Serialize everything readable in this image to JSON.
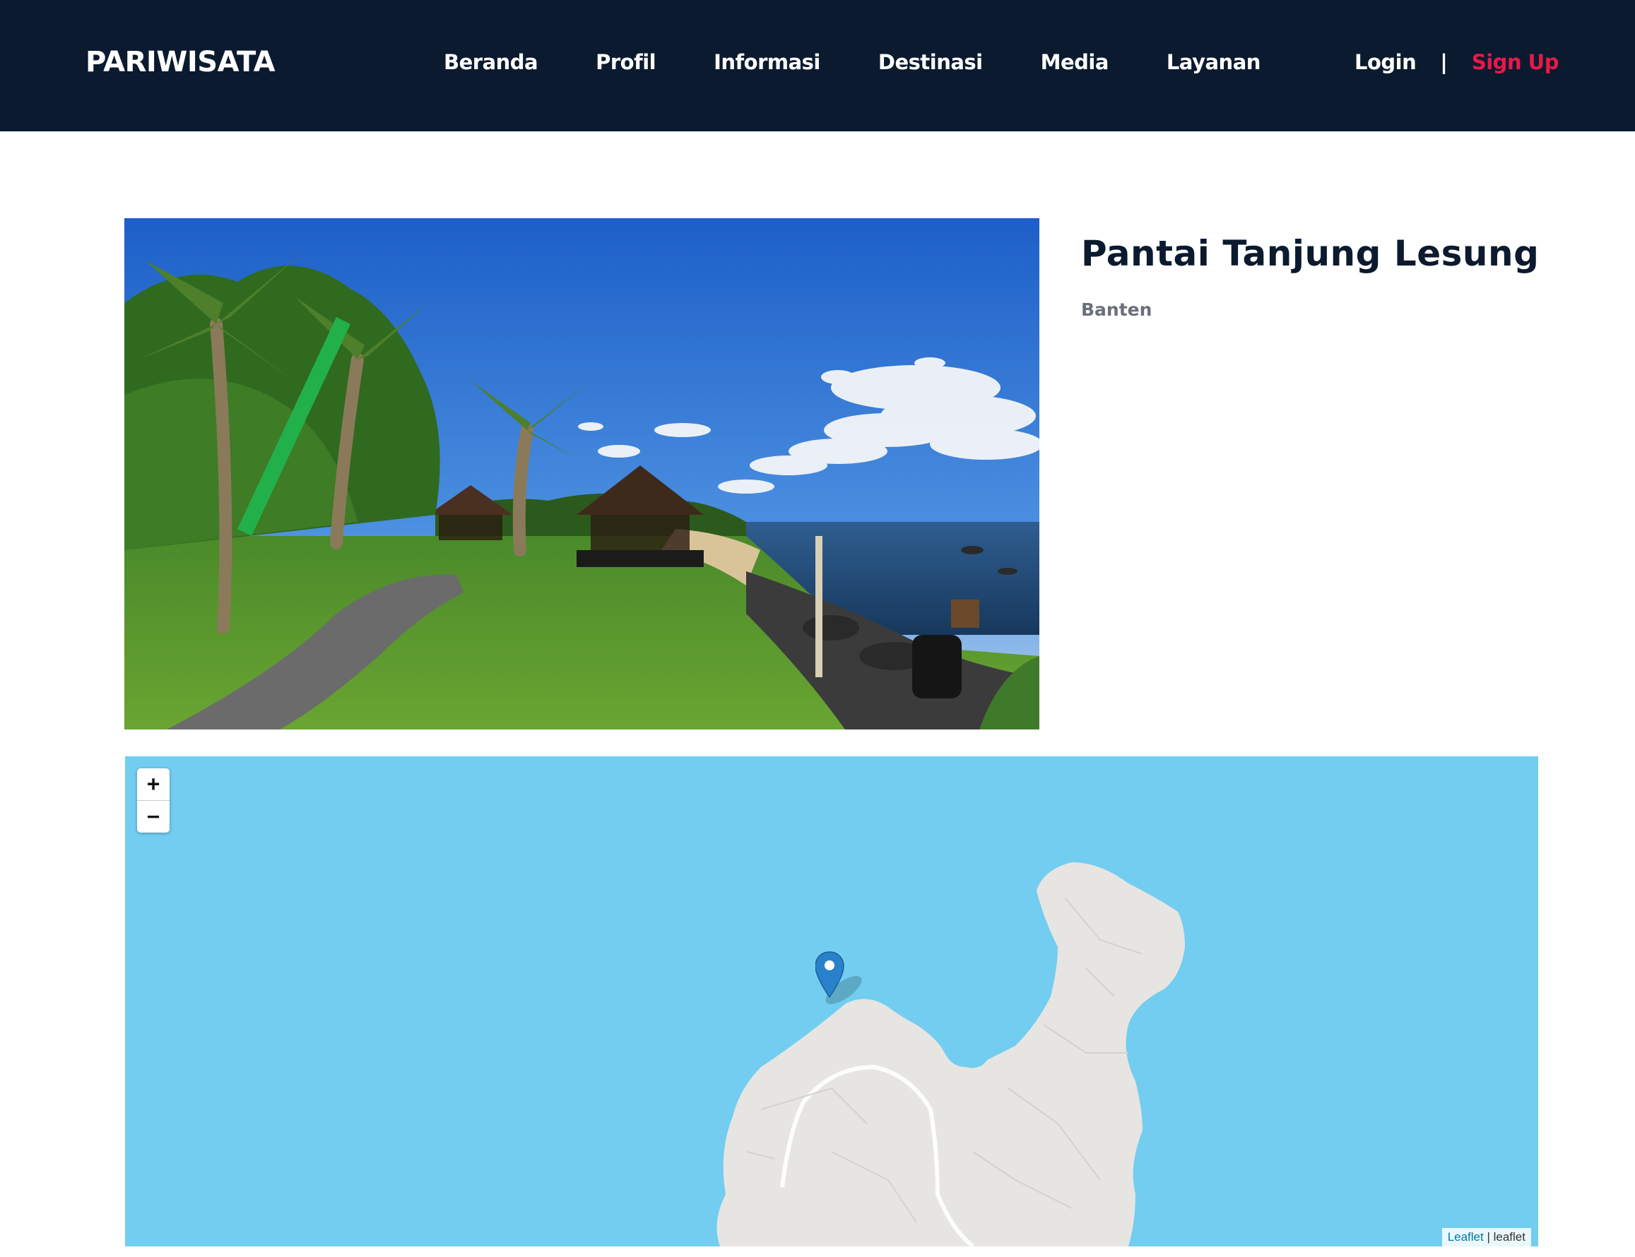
{
  "nav": {
    "brand": "PARIWISATA",
    "links": [
      "Beranda",
      "Profil",
      "Informasi",
      "Destinasi",
      "Media",
      "Layanan"
    ],
    "login": "Login",
    "separator": "|",
    "signup": "Sign Up"
  },
  "colors": {
    "navbar_bg": "#0b1a2e",
    "signup_accent": "#e8184a",
    "map_water": "#72cdf0",
    "map_land": "#e6e5e2",
    "marker": "#2a81cb"
  },
  "destination": {
    "title": "Pantai Tanjung Lesung",
    "region": "Banten"
  },
  "map": {
    "zoom_in": "+",
    "zoom_out": "−",
    "attribution_link": "Leaflet",
    "attribution_sep": "|",
    "attribution_text": "leaflet"
  }
}
